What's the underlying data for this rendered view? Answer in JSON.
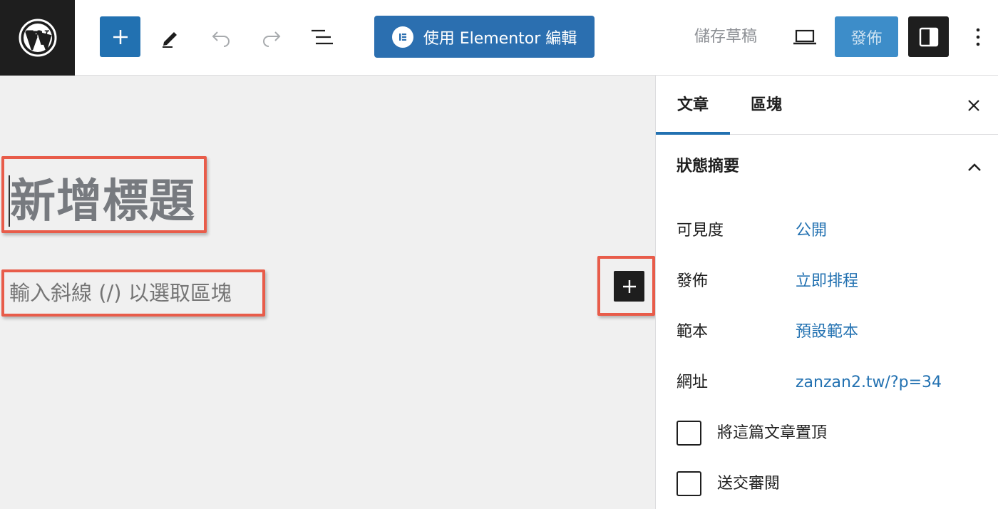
{
  "toolbar": {
    "elementor_label": "使用 Elementor 編輯",
    "save_draft_label": "儲存草稿",
    "publish_label": "發佈"
  },
  "editor": {
    "title_placeholder": "新增標題",
    "paragraph_placeholder": "輸入斜線 (/) 以選取區塊"
  },
  "sidebar": {
    "tabs": [
      {
        "label": "文章",
        "active": true
      },
      {
        "label": "區塊",
        "active": false
      }
    ],
    "panel_title": "狀態摘要",
    "rows": [
      {
        "label": "可見度",
        "value": "公開"
      },
      {
        "label": "發佈",
        "value": "立即排程"
      },
      {
        "label": "範本",
        "value": "預設範本"
      },
      {
        "label": "網址",
        "value": "zanzan2.tw/?p=34"
      }
    ],
    "checkboxes": [
      {
        "label": "將這篇文章置頂",
        "checked": false
      },
      {
        "label": "送交審閱",
        "checked": false
      }
    ]
  },
  "colors": {
    "accent": "#2271b1",
    "highlight_border": "#e85c4a",
    "dark": "#1e1e1e"
  }
}
